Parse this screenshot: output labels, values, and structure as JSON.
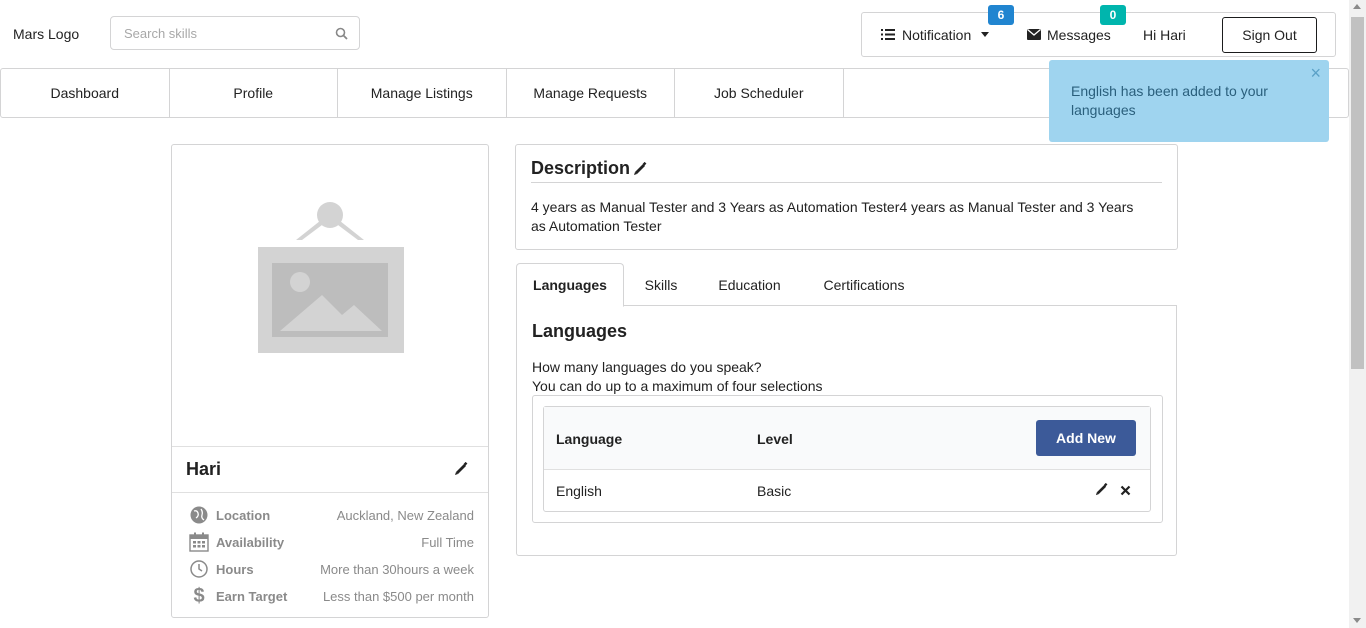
{
  "header": {
    "logo": "Mars Logo",
    "search_placeholder": "Search skills",
    "notification_label": "Notification",
    "notification_count": "6",
    "messages_label": "Messages",
    "messages_count": "0",
    "greeting": "Hi Hari",
    "sign_out": "Sign Out"
  },
  "nav": {
    "items": [
      {
        "label": "Dashboard"
      },
      {
        "label": "Profile"
      },
      {
        "label": "Manage Listings"
      },
      {
        "label": "Manage Requests"
      },
      {
        "label": "Job Scheduler"
      }
    ]
  },
  "toast": {
    "message": "English has been added to your languages",
    "close": "×"
  },
  "profile": {
    "name": "Hari",
    "details": [
      {
        "icon": "globe-icon",
        "label": "Location",
        "value": "Auckland, New Zealand"
      },
      {
        "icon": "calendar-icon",
        "label": "Availability",
        "value": "Full Time"
      },
      {
        "icon": "clock-icon",
        "label": "Hours",
        "value": "More than 30hours a week"
      },
      {
        "icon": "dollar-icon",
        "label": "Earn Target",
        "value": "Less than $500 per month"
      }
    ]
  },
  "description": {
    "title": "Description",
    "text": "4 years as Manual Tester and 3 Years as Automation Tester4 years as Manual Tester and 3 Years as Automation Tester"
  },
  "tabs": [
    {
      "label": "Languages",
      "active": true
    },
    {
      "label": "Skills",
      "active": false
    },
    {
      "label": "Education",
      "active": false
    },
    {
      "label": "Certifications",
      "active": false
    }
  ],
  "languages": {
    "title": "Languages",
    "question": "How many languages do you speak?",
    "hint": "You can do up to a maximum of four selections",
    "col_language": "Language",
    "col_level": "Level",
    "add_new": "Add New",
    "rows": [
      {
        "language": "English",
        "level": "Basic"
      }
    ]
  },
  "colors": {
    "accent": "#3c5a99",
    "badge_blue": "#2185d0",
    "badge_teal": "#00b5ad",
    "toast_bg": "#9fd4ef"
  }
}
